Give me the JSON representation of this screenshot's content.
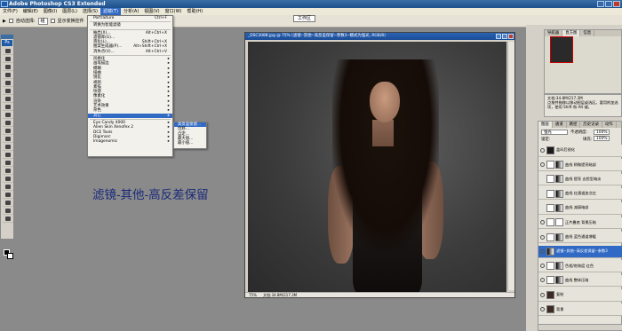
{
  "app": {
    "title": "Adobe Photoshop CS3 Extended"
  },
  "menubar": [
    "文件(F)",
    "编辑(E)",
    "图像(I)",
    "图层(L)",
    "选择(S)",
    "滤镜(T)",
    "分析(A)",
    "视图(V)",
    "窗口(W)",
    "帮助(H)"
  ],
  "optionsbar": {
    "auto_select": "自动选择:",
    "auto_select_value": "组",
    "show_transform": "显示变换控件",
    "workspace": "工作区"
  },
  "filter_menu": {
    "items": [
      {
        "label": "Portraiture",
        "shortcut": "Ctrl+F"
      },
      {
        "sep": true
      },
      {
        "label": "转换为智能滤镜"
      },
      {
        "sep": true
      },
      {
        "label": "抽出(X)...",
        "shortcut": "Alt+Ctrl+X"
      },
      {
        "label": "滤镜库(G)..."
      },
      {
        "label": "液化(L)...",
        "shortcut": "Shift+Ctrl+X"
      },
      {
        "label": "图案生成器(P)...",
        "shortcut": "Alt+Shift+Ctrl+X"
      },
      {
        "label": "消失点(V)...",
        "shortcut": "Alt+Ctrl+V"
      },
      {
        "sep": true
      },
      {
        "label": "风格化",
        "sub": true
      },
      {
        "label": "画笔描边",
        "sub": true
      },
      {
        "label": "模糊",
        "sub": true
      },
      {
        "label": "扭曲",
        "sub": true
      },
      {
        "label": "锐化",
        "sub": true
      },
      {
        "label": "视频",
        "sub": true
      },
      {
        "label": "素描",
        "sub": true
      },
      {
        "label": "纹理",
        "sub": true
      },
      {
        "label": "像素化",
        "sub": true
      },
      {
        "label": "渲染",
        "sub": true
      },
      {
        "label": "艺术效果",
        "sub": true
      },
      {
        "label": "杂色",
        "sub": true
      },
      {
        "label": "其它",
        "sub": true,
        "highlight": true
      },
      {
        "sep": true
      },
      {
        "label": "Eye Candy 4000",
        "sub": true
      },
      {
        "label": "Alien Skin Xenofex 2",
        "sub": true
      },
      {
        "label": "DCE Tools",
        "sub": true
      },
      {
        "label": "Digimarc",
        "sub": true
      },
      {
        "label": "Imagenomic",
        "sub": true
      }
    ]
  },
  "other_submenu": {
    "items": [
      {
        "label": "高反差保留...",
        "highlight": true
      },
      {
        "label": "位移..."
      },
      {
        "label": "自定..."
      },
      {
        "label": "最大值..."
      },
      {
        "label": "最小值..."
      }
    ]
  },
  "caption": {
    "text": "滤镜-其他-高反差保留"
  },
  "document": {
    "title": "_DSC3088.jpg @ 75% (滤镜--其他--高反差保留--参数3--模式为强光, RGB/8)",
    "zoom": "75%",
    "doc_size": "文档:34.8M/217.3M"
  },
  "panels": {
    "top_tabs": [
      "导航器",
      "直方图",
      "信息"
    ],
    "nav_tabs": [
      "颜色",
      "色板",
      "样式"
    ],
    "history_info": {
      "doc": "文档:34.8M/217.3M",
      "hint": "点按并拖移以移动图层或选区。要用附加选项，使用 Shift 和 Alt 键。"
    },
    "layers_tabs": [
      "图层",
      "通道",
      "路径",
      "历史记录",
      "动作"
    ],
    "blend_mode": "强光",
    "opacity_label": "不透明度:",
    "opacity": "100%",
    "lock_label": "锁定:",
    "fill_label": "填充:",
    "fill": "100%",
    "layers": [
      {
        "name": "盖印后锐化",
        "thumb": "d",
        "eye": true
      },
      {
        "name": "曲线 稍微提亮暗部",
        "thumb": "g",
        "eye": true,
        "adj": true
      },
      {
        "name": "曲线 提亮 去脸型暗淡",
        "thumb": "g",
        "eye": false,
        "adj": true
      },
      {
        "name": "曲线 红通道加点红",
        "thumb": "g",
        "eye": false,
        "adj": true
      },
      {
        "name": "曲线 减弱暗部",
        "thumb": "g",
        "eye": false,
        "adj": true
      },
      {
        "name": "正片叠底 背景压暗",
        "thumb": "w",
        "eye": true,
        "adj": true
      },
      {
        "name": "曲线 蓝色通道增暖",
        "thumb": "g",
        "eye": true,
        "adj": true
      },
      {
        "name": "滤镜--其他--高反差保留--参数3",
        "thumb": "g",
        "eye": true,
        "selected": true
      },
      {
        "name": "色相/饱和度 红色",
        "thumb": "g",
        "eye": true,
        "adj": true
      },
      {
        "name": "曲线 整体压暗",
        "thumb": "g",
        "eye": true,
        "adj": true
      },
      {
        "name": "复制",
        "thumb": "p",
        "eye": true
      },
      {
        "name": "背景",
        "thumb": "p",
        "eye": true
      }
    ]
  }
}
